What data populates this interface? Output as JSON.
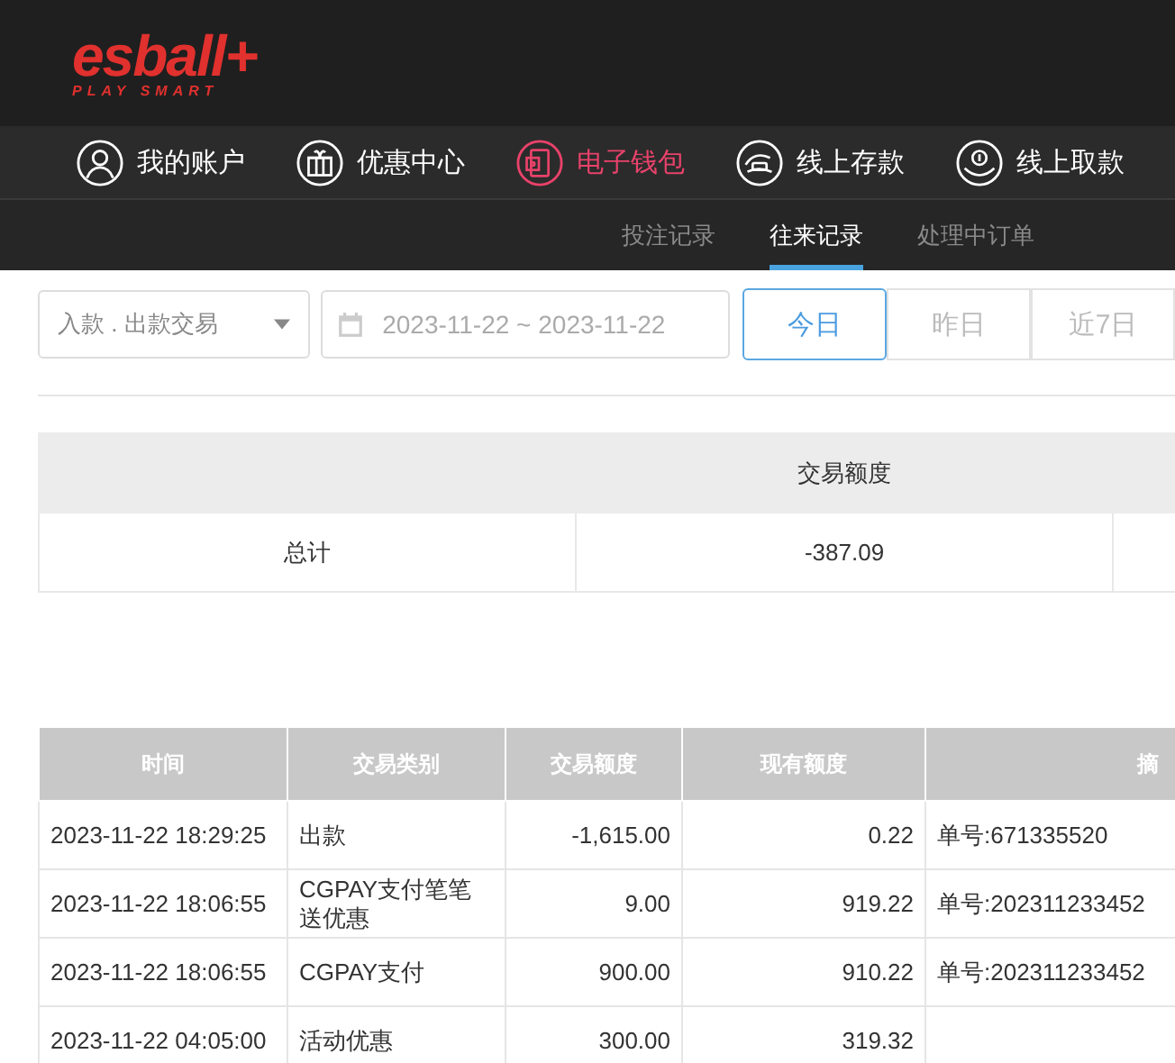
{
  "logo": {
    "name": "esball+",
    "tagline": "PLAY SMART"
  },
  "nav": [
    {
      "label": "我的账户",
      "kind": "user",
      "selected": false
    },
    {
      "label": "优惠中心",
      "kind": "gift",
      "selected": false
    },
    {
      "label": "电子钱包",
      "kind": "wallet",
      "selected": true
    },
    {
      "label": "线上存款",
      "kind": "deposit",
      "selected": false
    },
    {
      "label": "线上取款",
      "kind": "withdraw",
      "selected": false
    }
  ],
  "subnav": [
    {
      "label": "投注记录",
      "selected": false
    },
    {
      "label": "往来记录",
      "selected": true
    },
    {
      "label": "处理中订单",
      "selected": false
    }
  ],
  "filters": {
    "type_select": "入款 . 出款交易",
    "date_range": "2023-11-22 ~ 2023-11-22",
    "periods": [
      {
        "label": "今日",
        "selected": true
      },
      {
        "label": "昨日",
        "selected": false
      },
      {
        "label": "近7日",
        "selected": false
      }
    ]
  },
  "summary": {
    "heading": "交易额度",
    "label": "总计",
    "amount": "-387.09"
  },
  "table": {
    "columns": [
      "时间",
      "交易类别",
      "交易额度",
      "现有额度",
      "摘"
    ],
    "rows": [
      [
        "2023-11-22 18:29:25",
        "出款",
        "-1,615.00",
        "0.22",
        "单号:671335520"
      ],
      [
        "2023-11-22 18:06:55",
        "CGPAY支付笔笔送优惠",
        "9.00",
        "919.22",
        "单号:202311233452"
      ],
      [
        "2023-11-22 18:06:55",
        "CGPAY支付",
        "900.00",
        "910.22",
        "单号:202311233452"
      ],
      [
        "2023-11-22 04:05:00",
        "活动优惠",
        "300.00",
        "319.32",
        ""
      ]
    ]
  }
}
